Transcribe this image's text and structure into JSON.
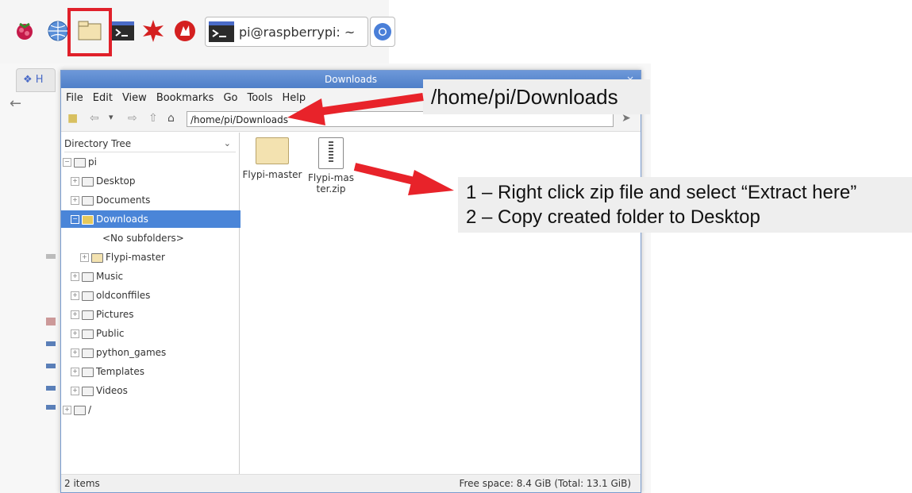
{
  "taskbar": {
    "icons": [
      "raspberry-menu-icon",
      "web-browser-icon",
      "file-manager-icon",
      "terminal-icon",
      "mathematica-icon",
      "wolfram-icon"
    ],
    "terminal_window_label": "pi@raspberrypi: ~",
    "highlight_color": "#e0202a"
  },
  "file_manager": {
    "title": "Downloads",
    "menu": [
      "File",
      "Edit",
      "View",
      "Bookmarks",
      "Go",
      "Tools",
      "Help"
    ],
    "path": "/home/pi/Downloads",
    "sidebar_mode": "Directory Tree",
    "tree": [
      {
        "label": "pi",
        "level": 0
      },
      {
        "label": "Desktop",
        "level": 1
      },
      {
        "label": "Documents",
        "level": 1
      },
      {
        "label": "Downloads",
        "level": 1,
        "selected": true
      },
      {
        "label": "<No subfolders>",
        "level": 2
      },
      {
        "label": "Flypi-master",
        "level": 2
      },
      {
        "label": "Music",
        "level": 1
      },
      {
        "label": "oldconffiles",
        "level": 1
      },
      {
        "label": "Pictures",
        "level": 1
      },
      {
        "label": "Public",
        "level": 1
      },
      {
        "label": "python_games",
        "level": 1
      },
      {
        "label": "Templates",
        "level": 1
      },
      {
        "label": "Videos",
        "level": 1
      },
      {
        "label": "/",
        "level": 0
      }
    ],
    "files": [
      {
        "name": "Flypi-master",
        "type": "folder"
      },
      {
        "name": "Flypi-master.zip",
        "type": "zip"
      }
    ],
    "status_items": "2 items",
    "status_space": "Free space: 8.4 GiB (Total: 13.1 GiB)",
    "selection_color": "#4a85d8"
  },
  "callouts": {
    "path_label": "/home/pi/Downloads",
    "step1": "1 – Right click zip file and select “Extract here”",
    "step2": "2 – Copy created folder to Desktop",
    "arrow_color": "#e8232a"
  }
}
